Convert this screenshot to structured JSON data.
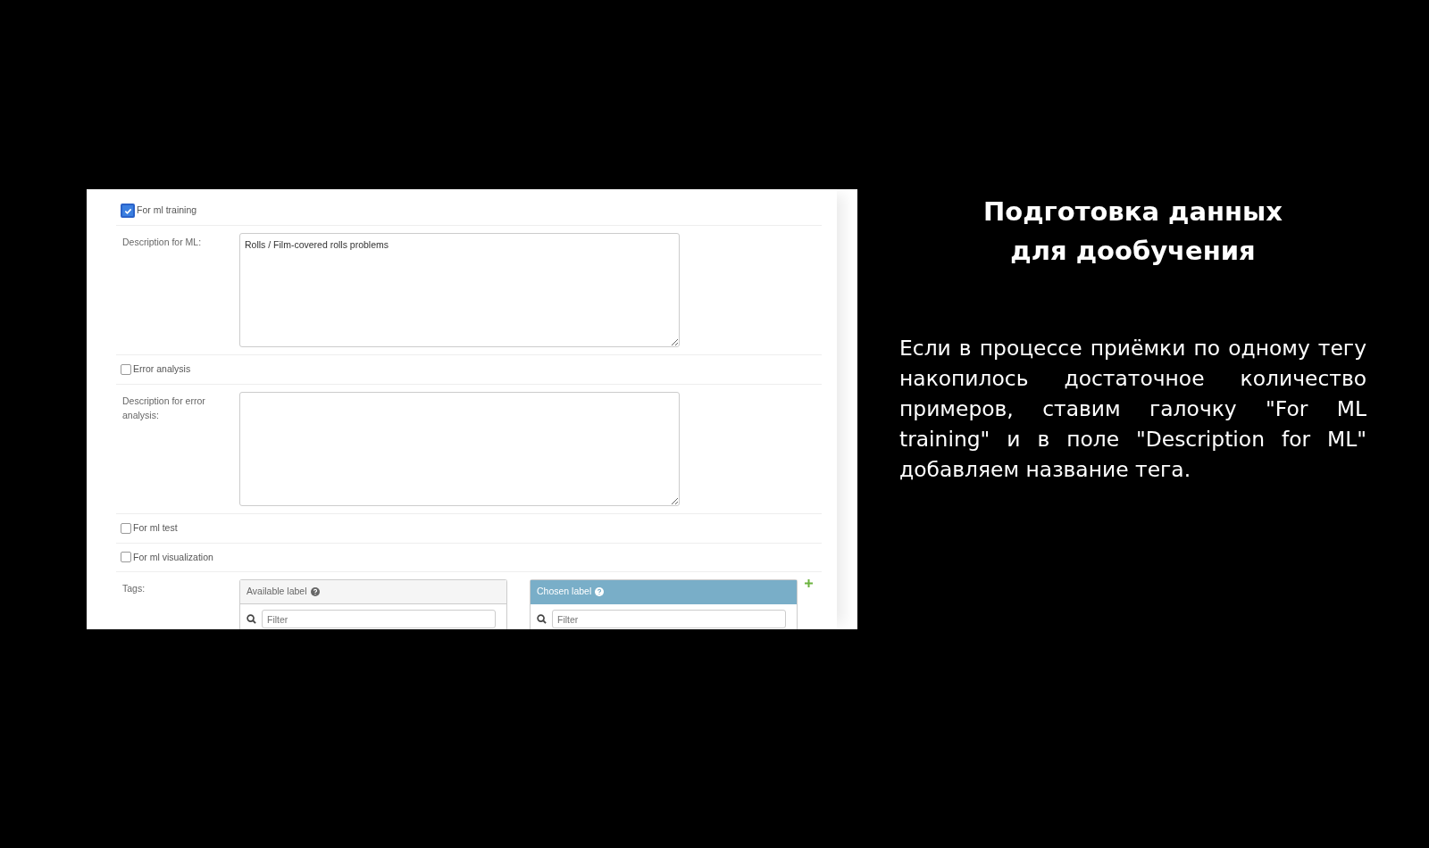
{
  "form": {
    "rows": [
      {
        "kind": "checkbox",
        "label": "For ml training",
        "checked": true
      },
      {
        "kind": "textarea",
        "label": "Description for ML:",
        "value": "Rolls / Film-covered rolls problems"
      },
      {
        "kind": "checkbox",
        "label": "Error analysis",
        "checked": false
      },
      {
        "kind": "textarea",
        "label": "Description for error analysis:",
        "value": ""
      },
      {
        "kind": "checkbox",
        "label": "For ml test",
        "checked": false
      },
      {
        "kind": "checkbox",
        "label": "For ml visualization",
        "checked": false
      },
      {
        "kind": "tags",
        "label": "Tags:",
        "selectors": [
          {
            "kind": "available",
            "title": "Available label",
            "placeholder": "Filter"
          },
          {
            "kind": "chosen",
            "title": "Chosen label",
            "placeholder": "Filter"
          }
        ]
      }
    ]
  },
  "slide": {
    "title_lines": [
      "Подготовка данных",
      "для дообучения"
    ],
    "paragraph": "Если в процессе приёмки по одному тегу накопилось достаточное количество примеров, ставим галочку \"For ML training\" и в поле \"Description for ML\" добавляем название тега."
  }
}
